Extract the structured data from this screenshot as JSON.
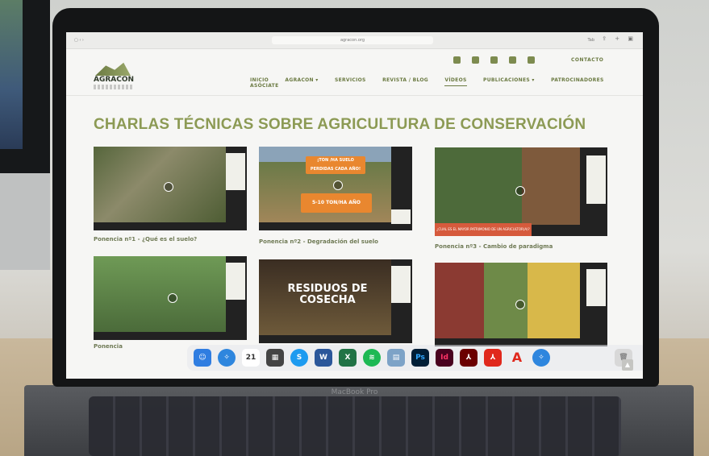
{
  "browser": {
    "url": "agracon.org",
    "tab_right": "Tab",
    "icons": [
      "share-icon",
      "plus-icon",
      "tabs-icon"
    ]
  },
  "site": {
    "logo_text": "AGRACON",
    "social_icons": [
      "facebook-icon",
      "instagram-icon",
      "twitter-icon",
      "youtube-icon",
      "linkedin-icon"
    ],
    "contact": "CONTACTO",
    "nav": [
      {
        "label": "INICIO"
      },
      {
        "label": "AGRACON ▾"
      },
      {
        "label": "SERVICIOS"
      },
      {
        "label": "REVISTA / BLOG"
      },
      {
        "label": "VÍDEOS",
        "active": true
      },
      {
        "label": "PUBLICACIONES ▾"
      },
      {
        "label": "PATROCINADORES"
      },
      {
        "label": "ASÓCIATE"
      }
    ],
    "page_title": "CHARLAS TÉCNICAS SOBRE AGRICULTURA DE CONSERVACIÓN"
  },
  "videos": [
    {
      "caption": "Ponencia nº1 - ¿Qué es el suelo?"
    },
    {
      "caption": "Ponencia nº2 - Degradación del suelo",
      "overlay1": "¡TON /HA SUELO PERDIDAS CADA AÑO!",
      "overlay2": "5-10 TON/HA AÑO"
    },
    {
      "caption": "Ponencia nº3 - Cambio de paradigma",
      "overlay1": "¿CUAL ES EL MAYOR PATRIMONIO DE UN AGRICULTOR(A)?"
    },
    {
      "caption": "Ponencia"
    },
    {
      "caption": "",
      "overlay1": "RESIDUOS DE COSECHA"
    },
    {
      "caption": ""
    }
  ],
  "dock": {
    "calendar_day": "21",
    "apps": [
      "finder-icon",
      "safari-icon",
      "calendar-icon",
      "calculator-icon",
      "skype-icon",
      "word-icon",
      "excel-icon",
      "spotify-icon",
      "preview-icon",
      "photoshop-icon",
      "indesign-icon",
      "acrobat-icon",
      "acrobat-reader-icon",
      "autocad-icon",
      "safari-icon-2",
      "trash-icon"
    ],
    "ps": "Ps",
    "id": "Id"
  },
  "laptop": {
    "label": "MacBook Pro"
  }
}
